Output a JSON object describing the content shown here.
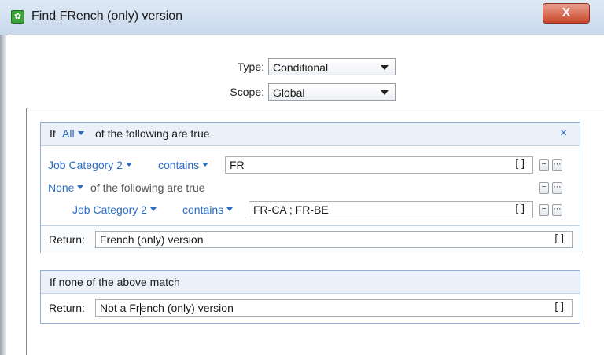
{
  "window": {
    "title": "Find FRench (only) version",
    "close_label": "X"
  },
  "form": {
    "type_label": "Type:",
    "type_value": "Conditional",
    "scope_label": "Scope:",
    "scope_value": "Global"
  },
  "condition_block": {
    "header_prefix": "If",
    "quantifier": "All",
    "header_suffix": "of the following are true",
    "remove_label": "×",
    "rules": [
      {
        "field": "Job Category 2",
        "operator": "contains",
        "value": "FR",
        "expr_icon": "[]"
      }
    ],
    "nested": {
      "quantifier": "None",
      "suffix": "of the following are true",
      "rules": [
        {
          "field": "Job Category 2",
          "operator": "contains",
          "value": "FR-CA ; FR-BE",
          "expr_icon": "[]"
        }
      ]
    },
    "return_label": "Return:",
    "return_value": "French (only) version",
    "return_icon": "[]"
  },
  "fallback_block": {
    "header": "If none of the above match",
    "return_label": "Return:",
    "return_value_before_caret": "Not a Fr",
    "return_value_after_caret": "ench (only) version",
    "return_icon": "[]"
  },
  "icons": {
    "app": "gear-icon",
    "dropdown": "chevron-down-icon"
  }
}
